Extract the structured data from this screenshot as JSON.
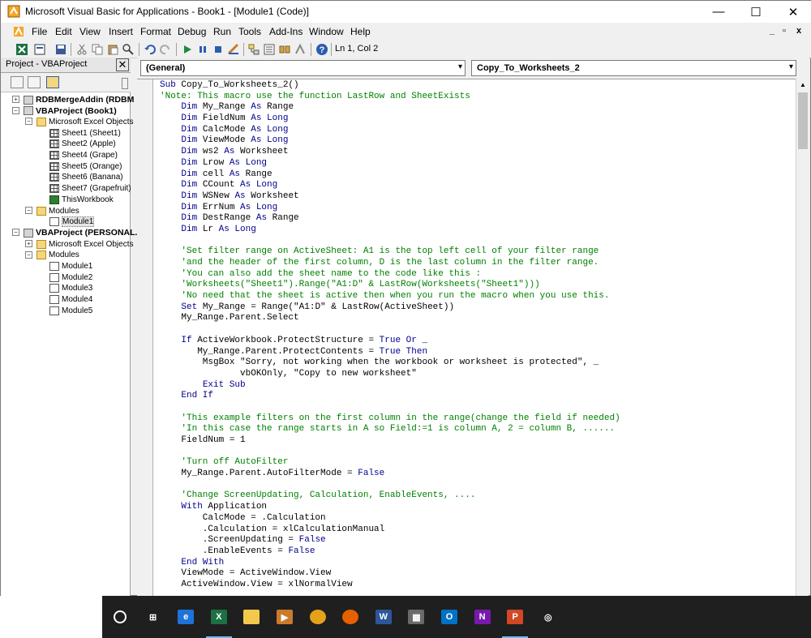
{
  "window": {
    "title": "Microsoft Visual Basic for Applications - Book1 - [Module1 (Code)]",
    "min_glyph": "—",
    "max_glyph": "☐",
    "close_glyph": "✕"
  },
  "menubar": {
    "items": [
      "File",
      "Edit",
      "View",
      "Insert",
      "Format",
      "Debug",
      "Run",
      "Tools",
      "Add-Ins",
      "Window",
      "Help"
    ],
    "mdi_controls": [
      "_",
      "▫",
      "x"
    ]
  },
  "toolbar": {
    "status": "Ln 1, Col 2",
    "icons": [
      "excel-icon",
      "insert-module-icon",
      "save-icon",
      "cut-icon",
      "copy-icon",
      "paste-icon",
      "find-icon",
      "undo-icon",
      "redo-icon",
      "run-icon",
      "break-icon",
      "reset-icon",
      "design-mode-icon",
      "project-explorer-icon",
      "properties-icon",
      "object-browser-icon",
      "toolbox-icon",
      "help-icon"
    ]
  },
  "project": {
    "title": "Project - VBAProject",
    "close_glyph": "✕",
    "tree": [
      {
        "label": "RDBMergeAddin (RDBM",
        "level": 0,
        "bold": true,
        "type": "proj",
        "exp": "+"
      },
      {
        "label": "VBAProject (Book1)",
        "level": 0,
        "bold": true,
        "type": "proj",
        "exp": "−"
      },
      {
        "label": "Microsoft Excel Objects",
        "level": 1,
        "type": "folder",
        "exp": "−"
      },
      {
        "label": "Sheet1 (Sheet1)",
        "level": 2,
        "type": "sheet"
      },
      {
        "label": "Sheet2 (Apple)",
        "level": 2,
        "type": "sheet"
      },
      {
        "label": "Sheet4 (Grape)",
        "level": 2,
        "type": "sheet"
      },
      {
        "label": "Sheet5 (Orange)",
        "level": 2,
        "type": "sheet"
      },
      {
        "label": "Sheet6 (Banana)",
        "level": 2,
        "type": "sheet"
      },
      {
        "label": "Sheet7 (Grapefruit)",
        "level": 2,
        "type": "sheet"
      },
      {
        "label": "ThisWorkbook",
        "level": 2,
        "type": "wb"
      },
      {
        "label": "Modules",
        "level": 1,
        "type": "folder",
        "exp": "−"
      },
      {
        "label": "Module1",
        "level": 2,
        "type": "mod",
        "selected": true
      },
      {
        "label": "VBAProject (PERSONAL.",
        "level": 0,
        "bold": true,
        "type": "proj",
        "exp": "−"
      },
      {
        "label": "Microsoft Excel Objects",
        "level": 1,
        "type": "folder",
        "exp": "+"
      },
      {
        "label": "Modules",
        "level": 1,
        "type": "folder",
        "exp": "−"
      },
      {
        "label": "Module1",
        "level": 2,
        "type": "mod"
      },
      {
        "label": "Module2",
        "level": 2,
        "type": "mod"
      },
      {
        "label": "Module3",
        "level": 2,
        "type": "mod"
      },
      {
        "label": "Module4",
        "level": 2,
        "type": "mod"
      },
      {
        "label": "Module5",
        "level": 2,
        "type": "mod"
      }
    ]
  },
  "code_window": {
    "object_combo": "(General)",
    "proc_combo": "Copy_To_Worksheets_2",
    "lines": [
      [
        {
          "t": "Sub",
          "k": 1
        },
        {
          "t": " Copy_To_Worksheets_2()"
        }
      ],
      [
        {
          "t": "'Note: This macro use the function LastRow and SheetExists",
          "c": 1
        }
      ],
      [
        {
          "t": "    "
        },
        {
          "t": "Dim",
          "k": 1
        },
        {
          "t": " My_Range "
        },
        {
          "t": "As",
          "k": 1
        },
        {
          "t": " Range"
        }
      ],
      [
        {
          "t": "    "
        },
        {
          "t": "Dim",
          "k": 1
        },
        {
          "t": " FieldNum "
        },
        {
          "t": "As Long",
          "k": 1
        }
      ],
      [
        {
          "t": "    "
        },
        {
          "t": "Dim",
          "k": 1
        },
        {
          "t": " CalcMode "
        },
        {
          "t": "As Long",
          "k": 1
        }
      ],
      [
        {
          "t": "    "
        },
        {
          "t": "Dim",
          "k": 1
        },
        {
          "t": " ViewMode "
        },
        {
          "t": "As Long",
          "k": 1
        }
      ],
      [
        {
          "t": "    "
        },
        {
          "t": "Dim",
          "k": 1
        },
        {
          "t": " ws2 "
        },
        {
          "t": "As",
          "k": 1
        },
        {
          "t": " Worksheet"
        }
      ],
      [
        {
          "t": "    "
        },
        {
          "t": "Dim",
          "k": 1
        },
        {
          "t": " Lrow "
        },
        {
          "t": "As Long",
          "k": 1
        }
      ],
      [
        {
          "t": "    "
        },
        {
          "t": "Dim",
          "k": 1
        },
        {
          "t": " cell "
        },
        {
          "t": "As",
          "k": 1
        },
        {
          "t": " Range"
        }
      ],
      [
        {
          "t": "    "
        },
        {
          "t": "Dim",
          "k": 1
        },
        {
          "t": " CCount "
        },
        {
          "t": "As Long",
          "k": 1
        }
      ],
      [
        {
          "t": "    "
        },
        {
          "t": "Dim",
          "k": 1
        },
        {
          "t": " WSNew "
        },
        {
          "t": "As",
          "k": 1
        },
        {
          "t": " Worksheet"
        }
      ],
      [
        {
          "t": "    "
        },
        {
          "t": "Dim",
          "k": 1
        },
        {
          "t": " ErrNum "
        },
        {
          "t": "As Long",
          "k": 1
        }
      ],
      [
        {
          "t": "    "
        },
        {
          "t": "Dim",
          "k": 1
        },
        {
          "t": " DestRange "
        },
        {
          "t": "As",
          "k": 1
        },
        {
          "t": " Range"
        }
      ],
      [
        {
          "t": "    "
        },
        {
          "t": "Dim",
          "k": 1
        },
        {
          "t": " Lr "
        },
        {
          "t": "As Long",
          "k": 1
        }
      ],
      [
        {
          "t": ""
        }
      ],
      [
        {
          "t": "    'Set filter range on ActiveSheet: A1 is the top left cell of your filter range",
          "c": 1
        }
      ],
      [
        {
          "t": "    'and the header of the first column, D is the last column in the filter range.",
          "c": 1
        }
      ],
      [
        {
          "t": "    'You can also add the sheet name to the code like this :",
          "c": 1
        }
      ],
      [
        {
          "t": "    'Worksheets(\"Sheet1\").Range(\"A1:D\" & LastRow(Worksheets(\"Sheet1\")))",
          "c": 1
        }
      ],
      [
        {
          "t": "    'No need that the sheet is active then when you run the macro when you use this.",
          "c": 1
        }
      ],
      [
        {
          "t": "    "
        },
        {
          "t": "Set",
          "k": 1
        },
        {
          "t": " My_Range = Range(\"A1:D\" & LastRow(ActiveSheet))"
        }
      ],
      [
        {
          "t": "    My_Range.Parent.Select"
        }
      ],
      [
        {
          "t": ""
        }
      ],
      [
        {
          "t": "    "
        },
        {
          "t": "If",
          "k": 1
        },
        {
          "t": " ActiveWorkbook.ProtectStructure = "
        },
        {
          "t": "True Or",
          "k": 1
        },
        {
          "t": " _"
        }
      ],
      [
        {
          "t": "       My_Range.Parent.ProtectContents = "
        },
        {
          "t": "True Then",
          "k": 1
        }
      ],
      [
        {
          "t": "        MsgBox \"Sorry, not working when the workbook or worksheet is protected\", _"
        }
      ],
      [
        {
          "t": "               vbOKOnly, \"Copy to new worksheet\""
        }
      ],
      [
        {
          "t": "        "
        },
        {
          "t": "Exit Sub",
          "k": 1
        }
      ],
      [
        {
          "t": "    "
        },
        {
          "t": "End If",
          "k": 1
        }
      ],
      [
        {
          "t": ""
        }
      ],
      [
        {
          "t": "    'This example filters on the first column in the range(change the field if needed)",
          "c": 1
        }
      ],
      [
        {
          "t": "    'In this case the range starts in A so Field:=1 is column A, 2 = column B, ......",
          "c": 1
        }
      ],
      [
        {
          "t": "    FieldNum = 1"
        }
      ],
      [
        {
          "t": ""
        }
      ],
      [
        {
          "t": "    'Turn off AutoFilter",
          "c": 1
        }
      ],
      [
        {
          "t": "    My_Range.Parent.AutoFilterMode = "
        },
        {
          "t": "False",
          "k": 1
        }
      ],
      [
        {
          "t": ""
        }
      ],
      [
        {
          "t": "    'Change ScreenUpdating, Calculation, EnableEvents, ....",
          "c": 1
        }
      ],
      [
        {
          "t": "    "
        },
        {
          "t": "With",
          "k": 1
        },
        {
          "t": " Application"
        }
      ],
      [
        {
          "t": "        CalcMode = .Calculation"
        }
      ],
      [
        {
          "t": "        .Calculation = xlCalculationManual"
        }
      ],
      [
        {
          "t": "        .ScreenUpdating = "
        },
        {
          "t": "False",
          "k": 1
        }
      ],
      [
        {
          "t": "        .EnableEvents = "
        },
        {
          "t": "False",
          "k": 1
        }
      ],
      [
        {
          "t": "    "
        },
        {
          "t": "End With",
          "k": 1
        }
      ],
      [
        {
          "t": "    ViewMode = ActiveWindow.View"
        }
      ],
      [
        {
          "t": "    ActiveWindow.View = xlNormalView"
        }
      ]
    ]
  },
  "taskbar": {
    "items": [
      {
        "name": "start-cortana-icon",
        "glyph": "○",
        "color": "#1f1f1f"
      },
      {
        "name": "task-view-icon",
        "glyph": "⊞",
        "color": "#1f1f1f"
      },
      {
        "name": "edge-icon",
        "glyph": "e",
        "color": "#1e73d8"
      },
      {
        "name": "excel-taskbar-icon",
        "glyph": "X",
        "color": "#1d7044",
        "active": true
      },
      {
        "name": "file-explorer-icon",
        "glyph": "",
        "color": "#f3c94b"
      },
      {
        "name": "video-app-icon",
        "glyph": "▶",
        "color": "#c97b2c"
      },
      {
        "name": "chrome-icon",
        "glyph": "",
        "color": "#e3a21a"
      },
      {
        "name": "firefox-icon",
        "glyph": "",
        "color": "#e66000"
      },
      {
        "name": "word-icon",
        "glyph": "W",
        "color": "#2b5797"
      },
      {
        "name": "calculator-icon",
        "glyph": "▦",
        "color": "#6a6a6a"
      },
      {
        "name": "outlook-icon",
        "glyph": "O",
        "color": "#0072c6"
      },
      {
        "name": "onenote-icon",
        "glyph": "N",
        "color": "#7719aa"
      },
      {
        "name": "powerpoint-icon",
        "glyph": "P",
        "color": "#d24726",
        "active": true
      },
      {
        "name": "app-swirl-icon",
        "glyph": "◎",
        "color": "#1f1f1f"
      }
    ]
  }
}
